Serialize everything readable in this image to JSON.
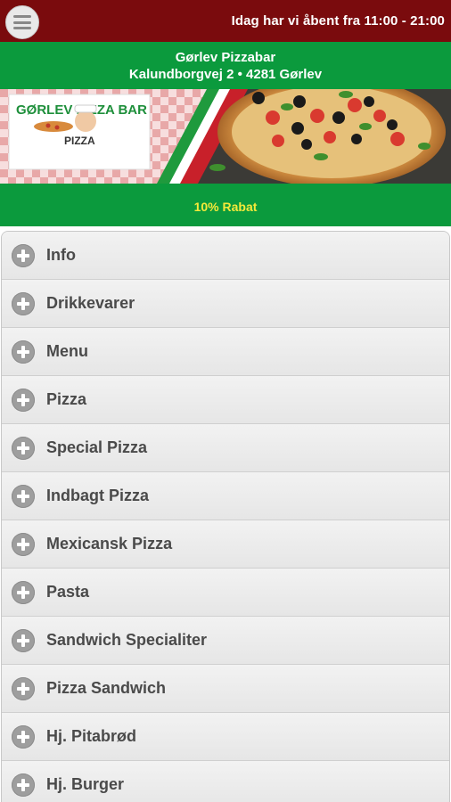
{
  "header": {
    "menu_icon": "hamburger-icon",
    "hours_text": "Idag har vi åbent fra 11:00 - 21:00"
  },
  "store": {
    "name": "Gørlev Pizzabar",
    "address": "Kalundborgvej 2 • 4281 Gørlev"
  },
  "banner": {
    "logo_text_top": "GØRLEV PIZZA BAR",
    "logo_text_bottom": "PIZZA"
  },
  "discount": {
    "label": "10% Rabat"
  },
  "colors": {
    "topbar": "#7a0b0d",
    "green": "#0b9a3d",
    "discount_text": "#f5e93a"
  },
  "menu": {
    "items": [
      {
        "label": "Info",
        "icon": "plus-circle-icon"
      },
      {
        "label": "Drikkevarer",
        "icon": "plus-circle-icon"
      },
      {
        "label": "Menu",
        "icon": "plus-circle-icon"
      },
      {
        "label": "Pizza",
        "icon": "plus-circle-icon"
      },
      {
        "label": "Special Pizza",
        "icon": "plus-circle-icon"
      },
      {
        "label": "Indbagt Pizza",
        "icon": "plus-circle-icon"
      },
      {
        "label": "Mexicansk Pizza",
        "icon": "plus-circle-icon"
      },
      {
        "label": "Pasta",
        "icon": "plus-circle-icon"
      },
      {
        "label": "Sandwich Specialiter",
        "icon": "plus-circle-icon"
      },
      {
        "label": "Pizza Sandwich",
        "icon": "plus-circle-icon"
      },
      {
        "label": "Hj. Pitabrød",
        "icon": "plus-circle-icon"
      },
      {
        "label": "Hj. Burger",
        "icon": "plus-circle-icon"
      }
    ]
  }
}
